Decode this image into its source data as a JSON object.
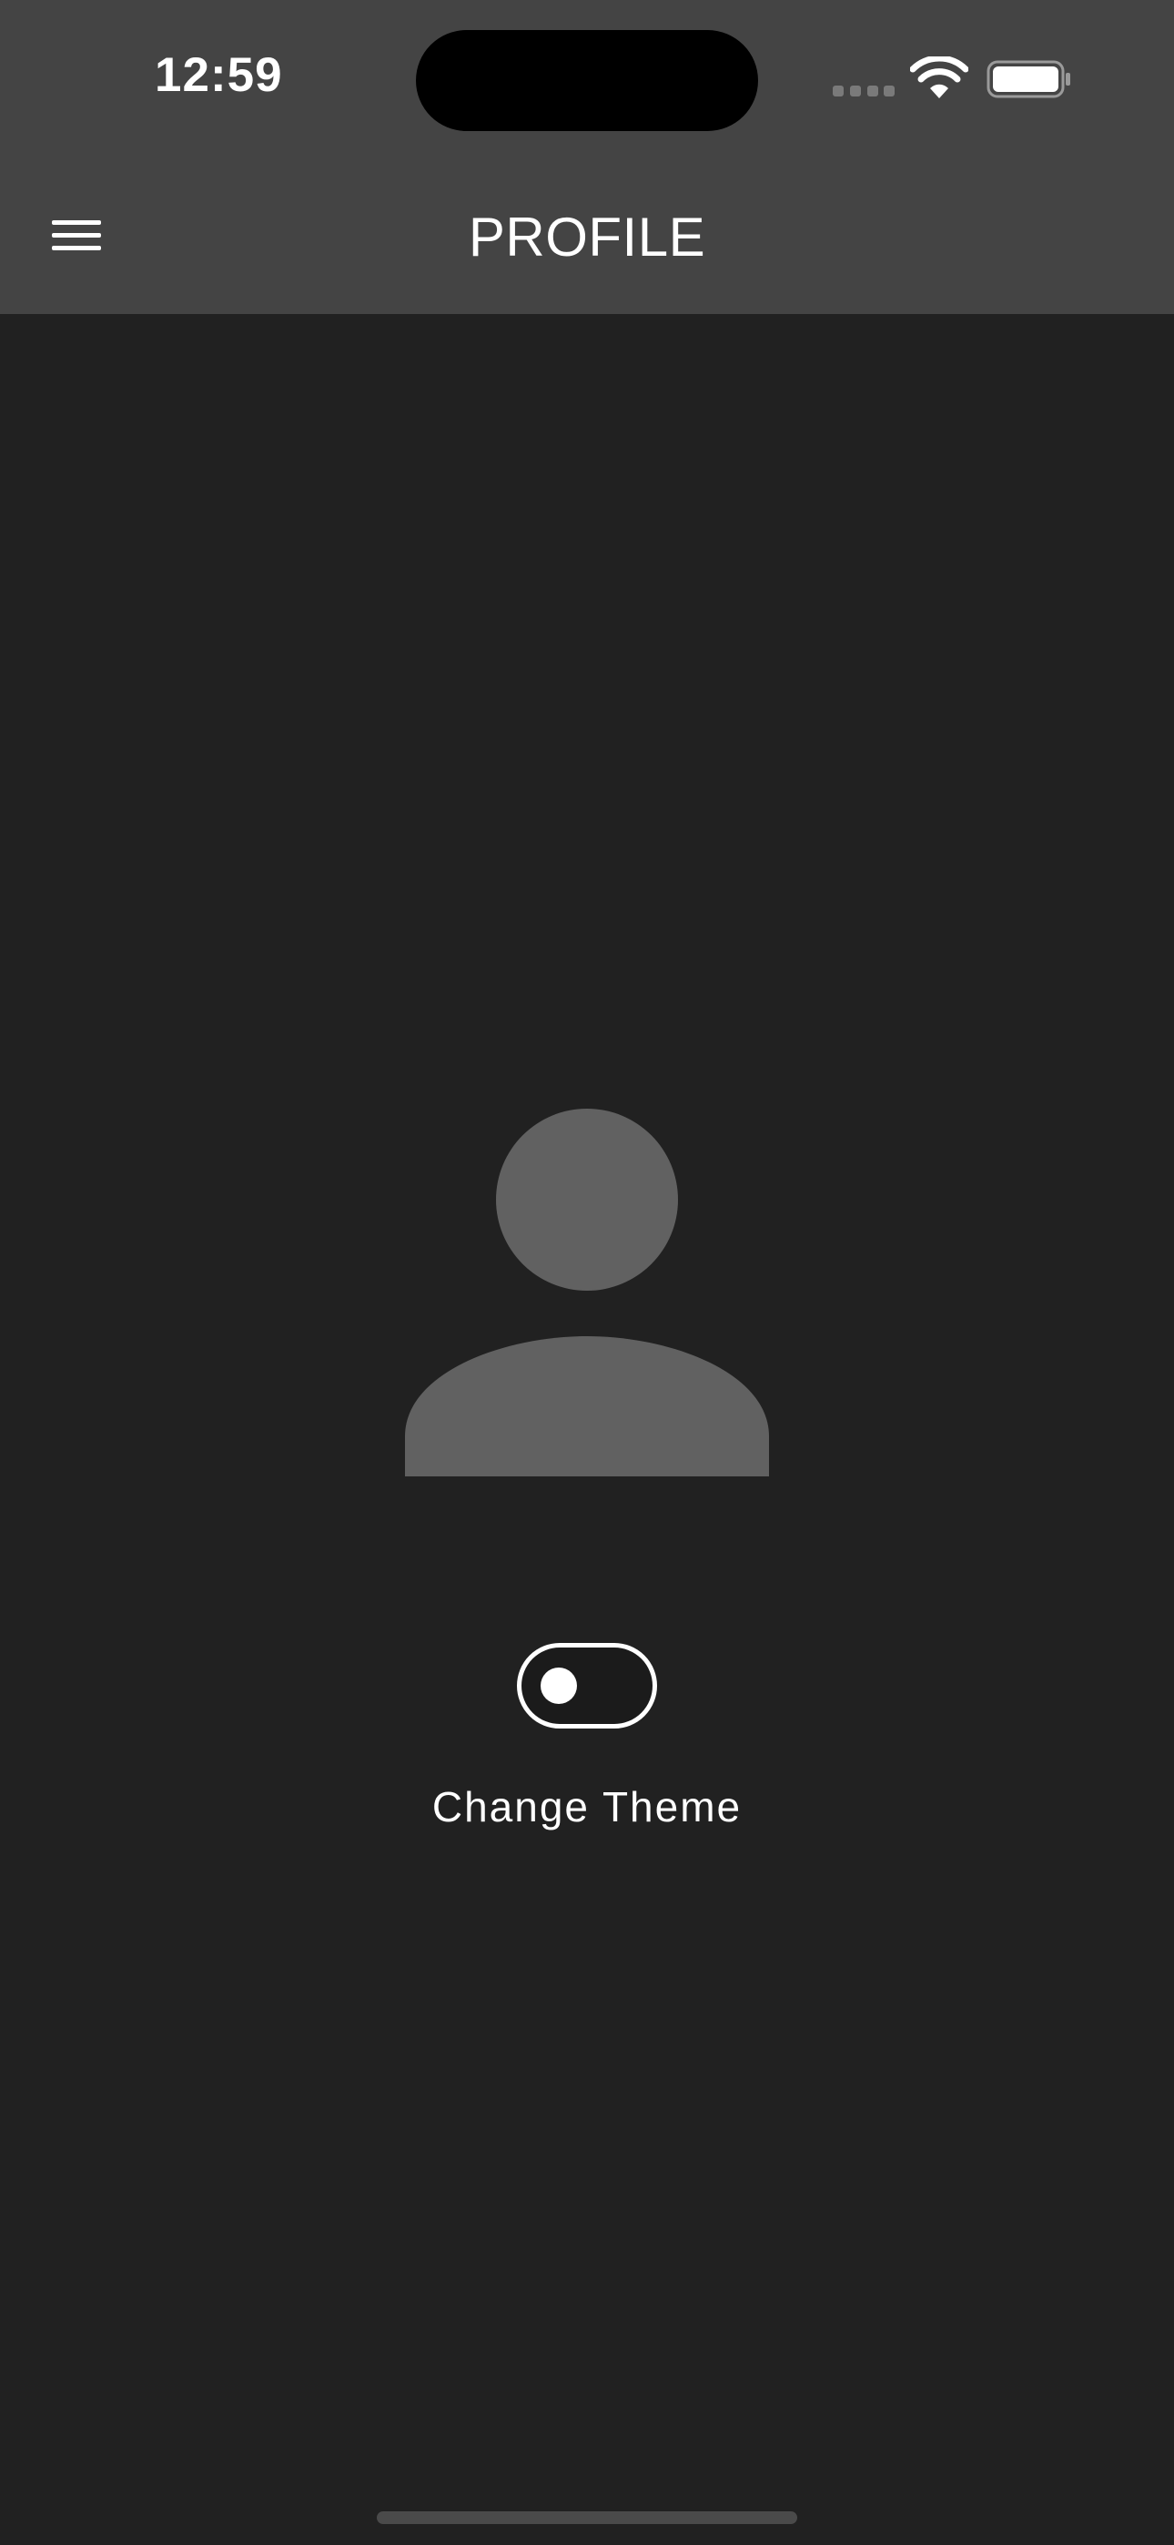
{
  "status_bar": {
    "time": "12:59",
    "icons": [
      "cellular-signal-icon",
      "wifi-icon",
      "battery-icon"
    ]
  },
  "app_bar": {
    "menu_icon": "hamburger-menu-icon",
    "title": "PROFILE"
  },
  "profile": {
    "avatar_icon": "user-avatar-placeholder-icon"
  },
  "theme_toggle": {
    "label": "Change Theme",
    "state": "off"
  },
  "colors": {
    "background": "#212121",
    "header": "#444444",
    "avatar": "#616161",
    "text": "#ffffff"
  }
}
